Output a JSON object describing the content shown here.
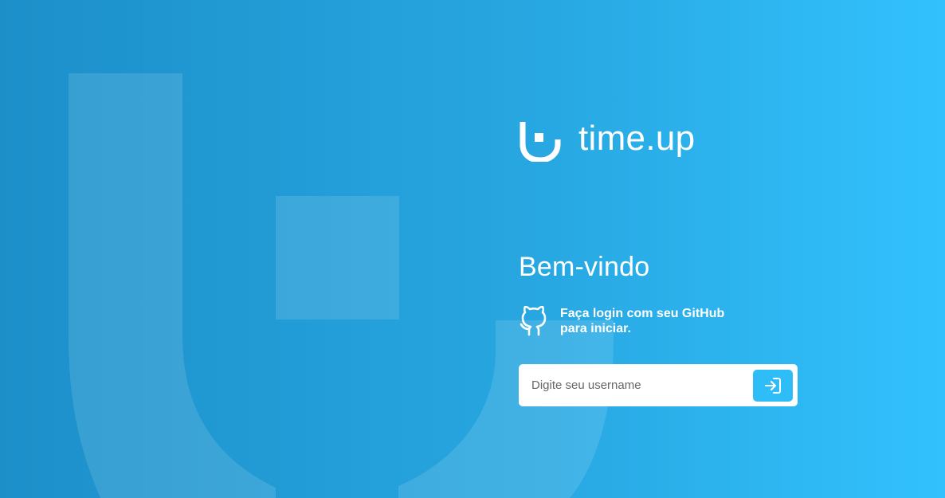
{
  "brand": {
    "name": "time.up",
    "logo_icon": "time-up-logo-icon"
  },
  "login": {
    "welcome_title": "Bem-vindo",
    "github_icon": "github-icon",
    "github_text": "Faça login com seu GitHub para iniciar.",
    "username_placeholder": "Digite seu username",
    "username_value": "",
    "submit_icon": "sign-in-arrow-icon"
  },
  "colors": {
    "background_start": "#1c8fc9",
    "background_end": "#32c1fd",
    "button": "#2fbdf7",
    "text": "#ffffff"
  }
}
